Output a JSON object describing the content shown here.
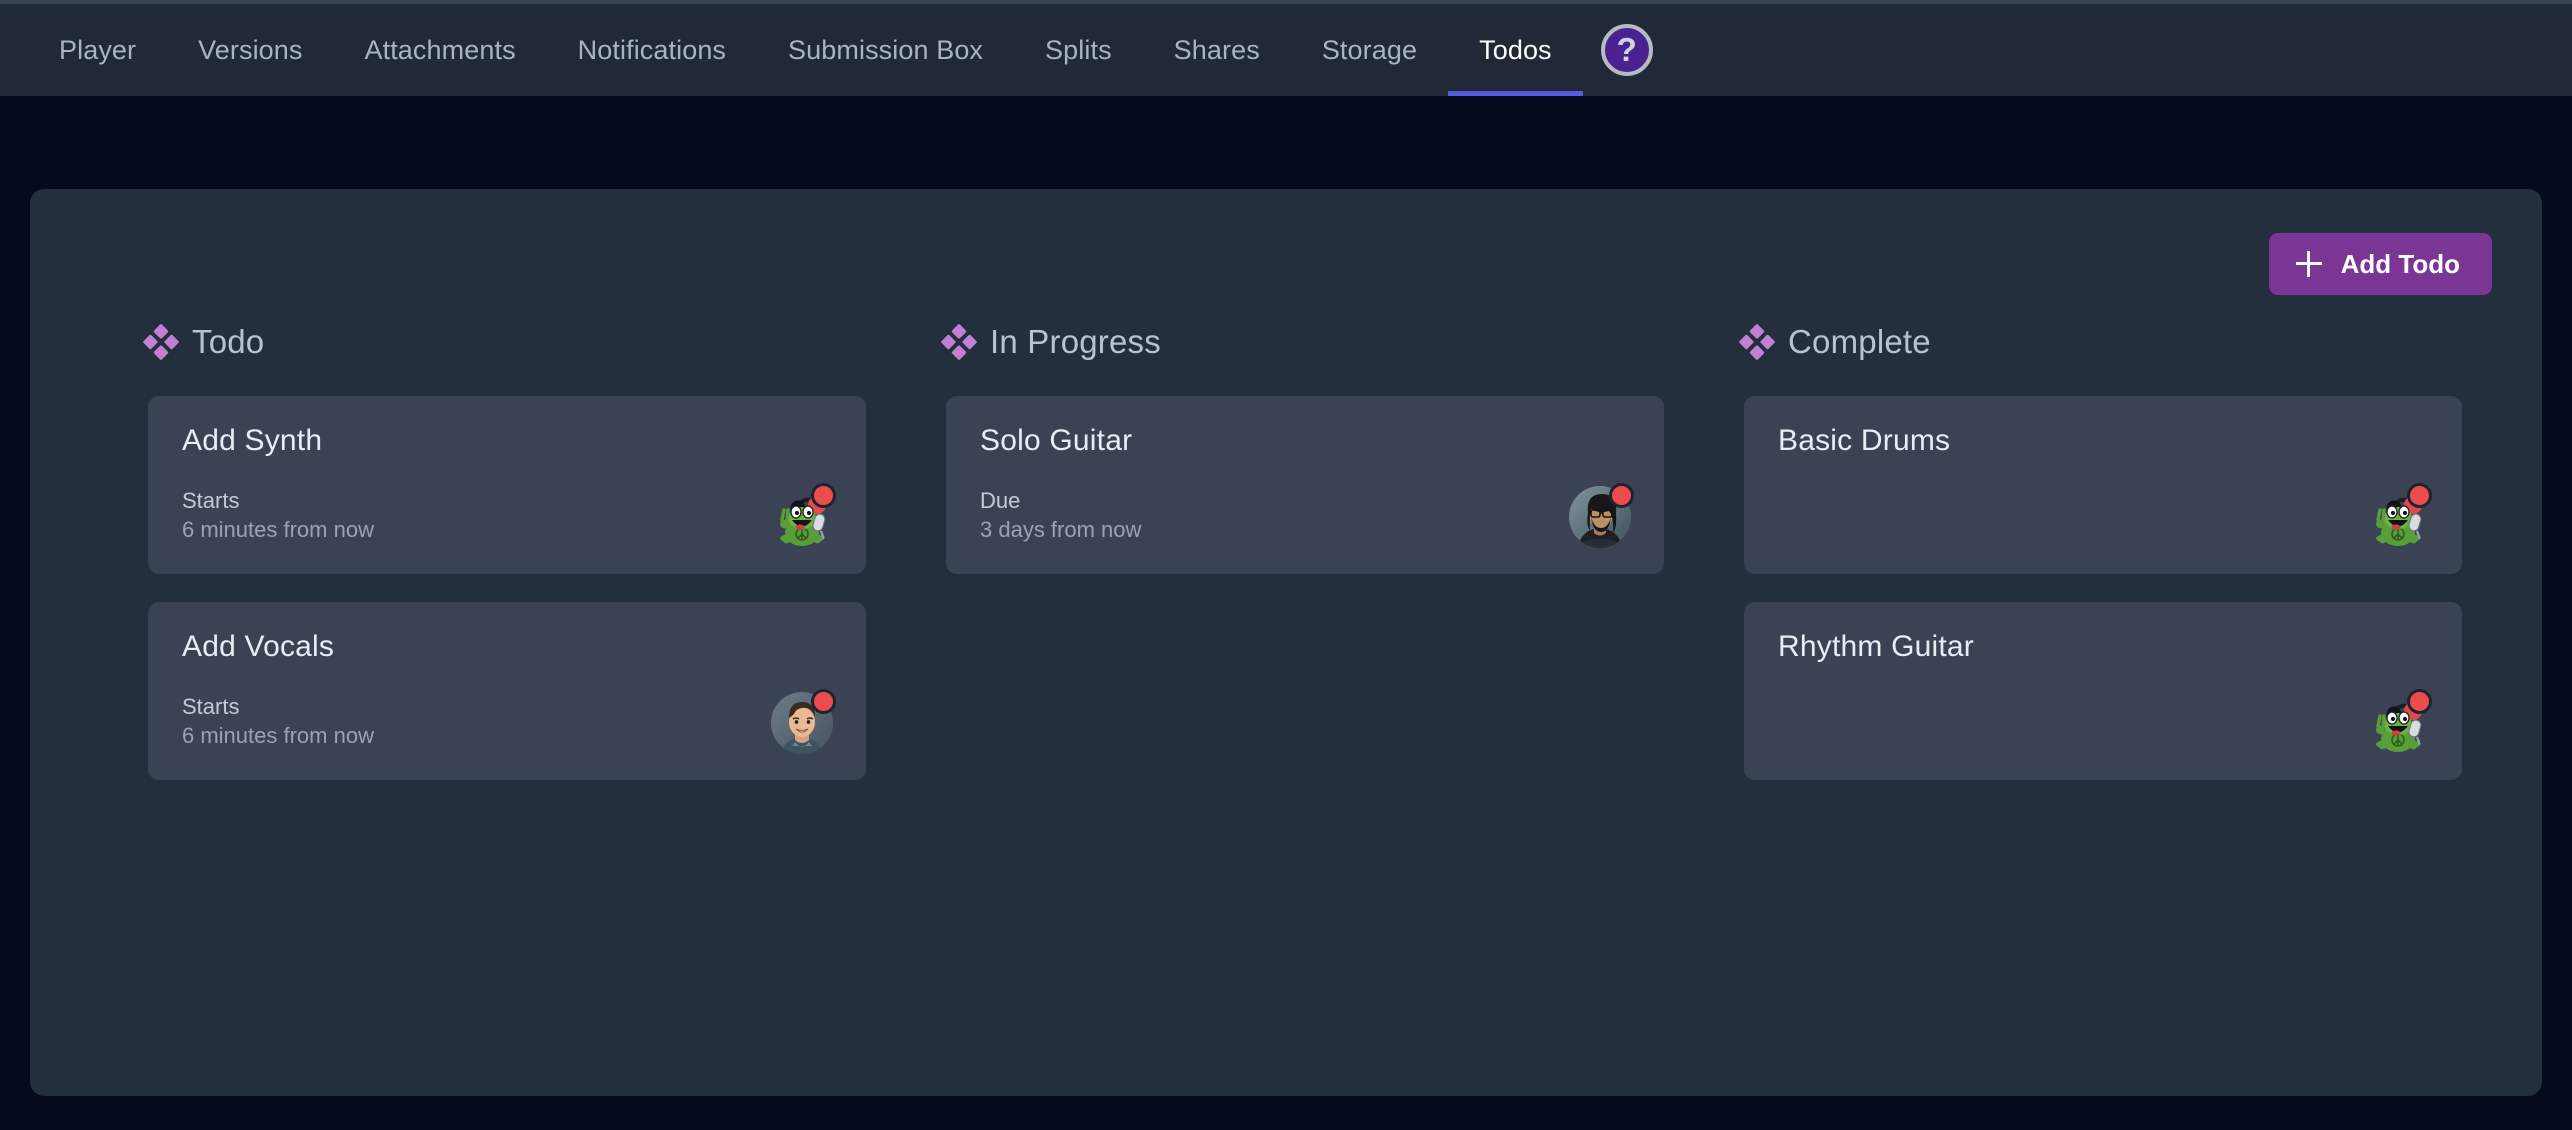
{
  "nav": {
    "tabs": [
      {
        "label": "Player",
        "active": false
      },
      {
        "label": "Versions",
        "active": false
      },
      {
        "label": "Attachments",
        "active": false
      },
      {
        "label": "Notifications",
        "active": false
      },
      {
        "label": "Submission Box",
        "active": false
      },
      {
        "label": "Splits",
        "active": false
      },
      {
        "label": "Shares",
        "active": false
      },
      {
        "label": "Storage",
        "active": false
      },
      {
        "label": "Todos",
        "active": true
      }
    ],
    "help_icon": "help-circle-icon",
    "help_glyph": "?",
    "active_underline_color": "#5a5ae0"
  },
  "toolbar": {
    "add_todo_label": "Add Todo",
    "add_todo_icon": "plus-icon",
    "add_todo_color": "#7b3695"
  },
  "board": {
    "column_icon": "four-diamond-icon",
    "column_icon_color": "#c27fd4",
    "columns": [
      {
        "title": "Todo",
        "cards": [
          {
            "title": "Add Synth",
            "meta_label": "Starts",
            "meta_value": "6 minutes from now",
            "avatar": "frog-musician-avatar",
            "status_color": "#ec4c4c"
          },
          {
            "title": "Add Vocals",
            "meta_label": "Starts",
            "meta_value": "6 minutes from now",
            "avatar": "smiling-man-photo-avatar",
            "status_color": "#ec4c4c"
          }
        ]
      },
      {
        "title": "In Progress",
        "cards": [
          {
            "title": "Solo Guitar",
            "meta_label": "Due",
            "meta_value": "3 days from now",
            "avatar": "bearded-person-glasses-photo-avatar",
            "status_color": "#ec4c4c"
          }
        ]
      },
      {
        "title": "Complete",
        "cards": [
          {
            "title": "Basic Drums",
            "meta_label": "",
            "meta_value": "",
            "avatar": "frog-musician-avatar",
            "status_color": "#ec4c4c"
          },
          {
            "title": "Rhythm Guitar",
            "meta_label": "",
            "meta_value": "",
            "avatar": "frog-musician-avatar",
            "status_color": "#ec4c4c"
          }
        ]
      }
    ]
  },
  "colors": {
    "page_background": "#050a1c",
    "nav_background": "#202935",
    "panel_background": "#242f3d",
    "card_background": "#3b4254",
    "accent_purple": "#7b3695",
    "accent_indigo": "#5a5ae0"
  }
}
